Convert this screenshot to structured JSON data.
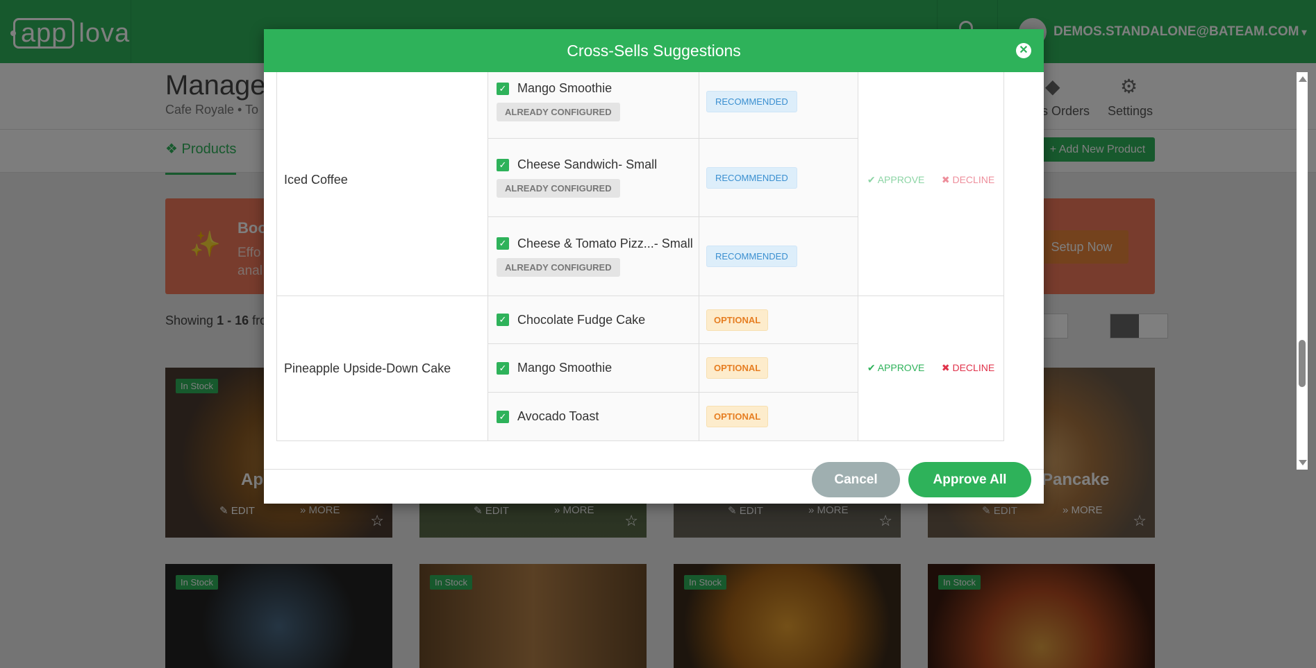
{
  "app": {
    "logo_box": "app",
    "logo_text": "lova",
    "user_email": "DEMOS.STANDALONE@BATEAM.COM",
    "page_title": "Manage",
    "breadcrumb": "Cafe Royale  •  To",
    "nav_orders": "s Orders",
    "nav_settings": "Settings",
    "tab_products": "Products",
    "add_product": "+ Add New Product",
    "banner_title": "Boo",
    "banner_sub1": "Effo",
    "banner_sub2": "anal",
    "setup_now": "Setup Now",
    "showing_prefix": "Showing ",
    "showing_range": "1 - 16",
    "showing_suffix": " fro",
    "cards": [
      {
        "badge": "In Stock",
        "name": "App",
        "edit": "EDIT",
        "more": "MORE"
      },
      {
        "badge": "",
        "name": "",
        "edit": "EDIT",
        "more": "MORE"
      },
      {
        "badge": "",
        "name": "",
        "edit": "EDIT",
        "more": "MORE"
      },
      {
        "badge": "",
        "name": "Pancake",
        "edit": "EDIT",
        "more": "MORE"
      },
      {
        "badge": "In Stock"
      },
      {
        "badge": "In Stock"
      },
      {
        "badge": "In Stock"
      },
      {
        "badge": "In Stock"
      }
    ]
  },
  "modal": {
    "title": "Cross-Sells Suggestions",
    "groups": [
      {
        "product": "Iced Coffee",
        "approve": "APPROVE",
        "decline": "DECLINE",
        "items": [
          {
            "name": "Mango Smoothie",
            "note": "ALREADY CONFIGURED",
            "status": "RECOMMENDED"
          },
          {
            "name": "Cheese Sandwich- Small",
            "note": "ALREADY CONFIGURED",
            "status": "RECOMMENDED"
          },
          {
            "name": "Cheese & Tomato Pizz...- Small",
            "note": "ALREADY CONFIGURED",
            "status": "RECOMMENDED"
          }
        ]
      },
      {
        "product": "Pineapple Upside-Down Cake",
        "approve": "APPROVE",
        "decline": "DECLINE",
        "items": [
          {
            "name": "Chocolate Fudge Cake",
            "status": "OPTIONAL"
          },
          {
            "name": "Mango Smoothie",
            "status": "OPTIONAL"
          },
          {
            "name": "Avocado Toast",
            "status": "OPTIONAL"
          }
        ]
      }
    ],
    "cancel": "Cancel",
    "approve_all": "Approve All"
  },
  "colors": {
    "brand": "#2eb25a",
    "decline": "#e0324a",
    "optional": "#e67e22",
    "recommended": "#3a8fd0"
  }
}
